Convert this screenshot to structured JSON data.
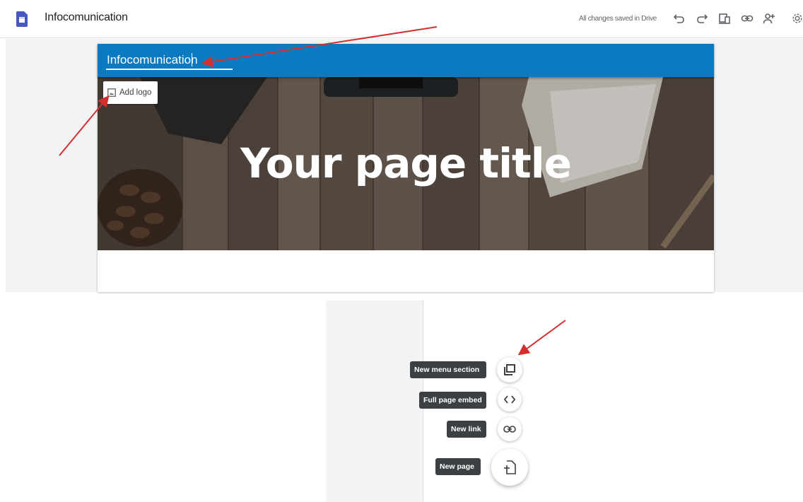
{
  "app": {
    "title": "Infocomunication",
    "save_status": "All changes saved in Drive",
    "toolbar_icons": [
      "undo-icon",
      "redo-icon",
      "preview-icon",
      "link-icon",
      "share-icon",
      "settings-icon"
    ]
  },
  "site": {
    "name": "Infocomunication",
    "page_title": "Your page title",
    "add_logo_label": "Add logo",
    "header_color": "#0c7ac1"
  },
  "insert_menu": {
    "items": [
      {
        "label": "New menu section",
        "icon": "menu-section-icon"
      },
      {
        "label": "Full page embed",
        "icon": "embed-code-icon"
      },
      {
        "label": "New link",
        "icon": "link-icon"
      },
      {
        "label": "New page",
        "icon": "new-page-icon"
      }
    ]
  },
  "annotation_color": "#d32f2f"
}
